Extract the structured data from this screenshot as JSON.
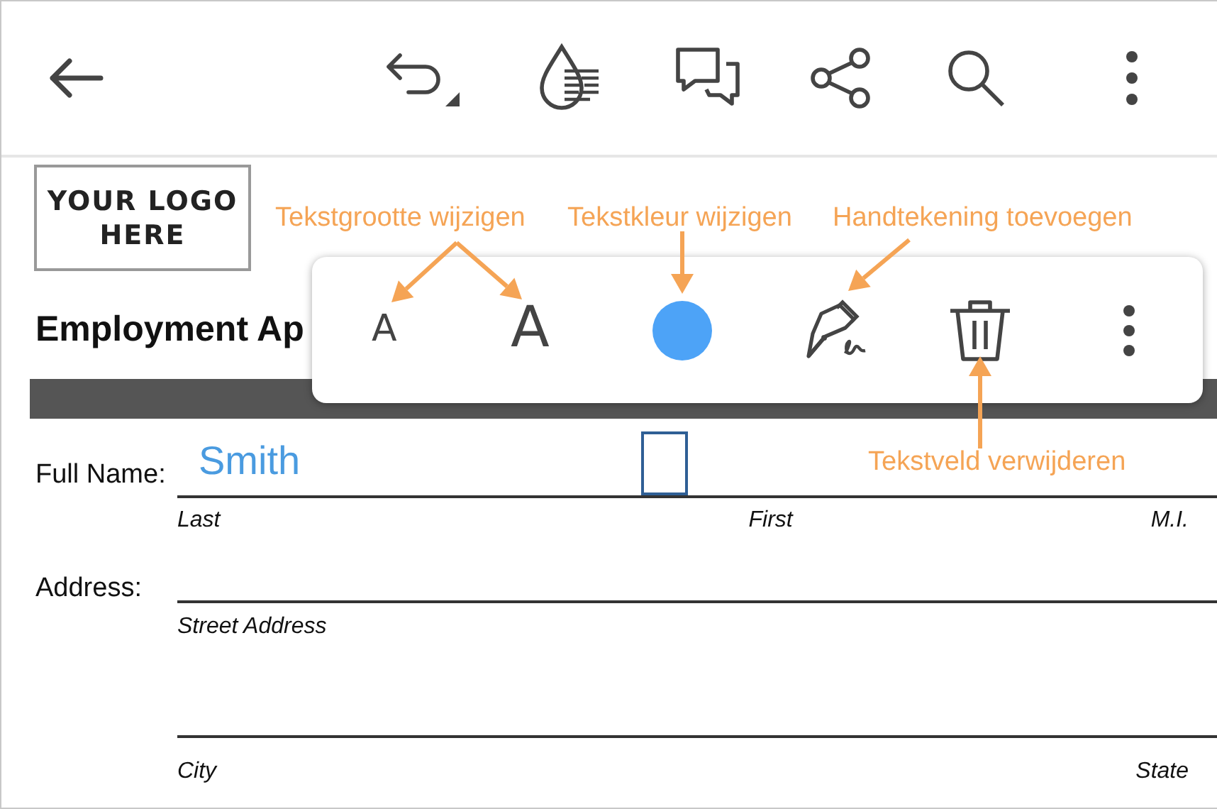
{
  "document": {
    "logo_lines": [
      "YOUR LOGO",
      "HERE"
    ],
    "title": "Employment Ap",
    "full_name": {
      "label": "Full Name:",
      "value": "Smith",
      "sublabels": [
        "Last",
        "First",
        "M.I."
      ]
    },
    "address": {
      "label": "Address:",
      "lines": [
        {
          "sublabels": [
            "Street Address"
          ]
        },
        {
          "sublabels": [
            "City",
            "State"
          ]
        }
      ]
    }
  },
  "popup": {
    "size_buttons": [
      {
        "label": "A",
        "kind": "smaller"
      },
      {
        "label": "A",
        "kind": "larger"
      }
    ]
  },
  "callouts": [
    {
      "label": "Tekstgrootte wijzigen"
    },
    {
      "label": "Tekstkleur wijzigen"
    },
    {
      "label": "Handtekening toevoegen"
    },
    {
      "label": "Tekstveld verwijderen"
    }
  ]
}
